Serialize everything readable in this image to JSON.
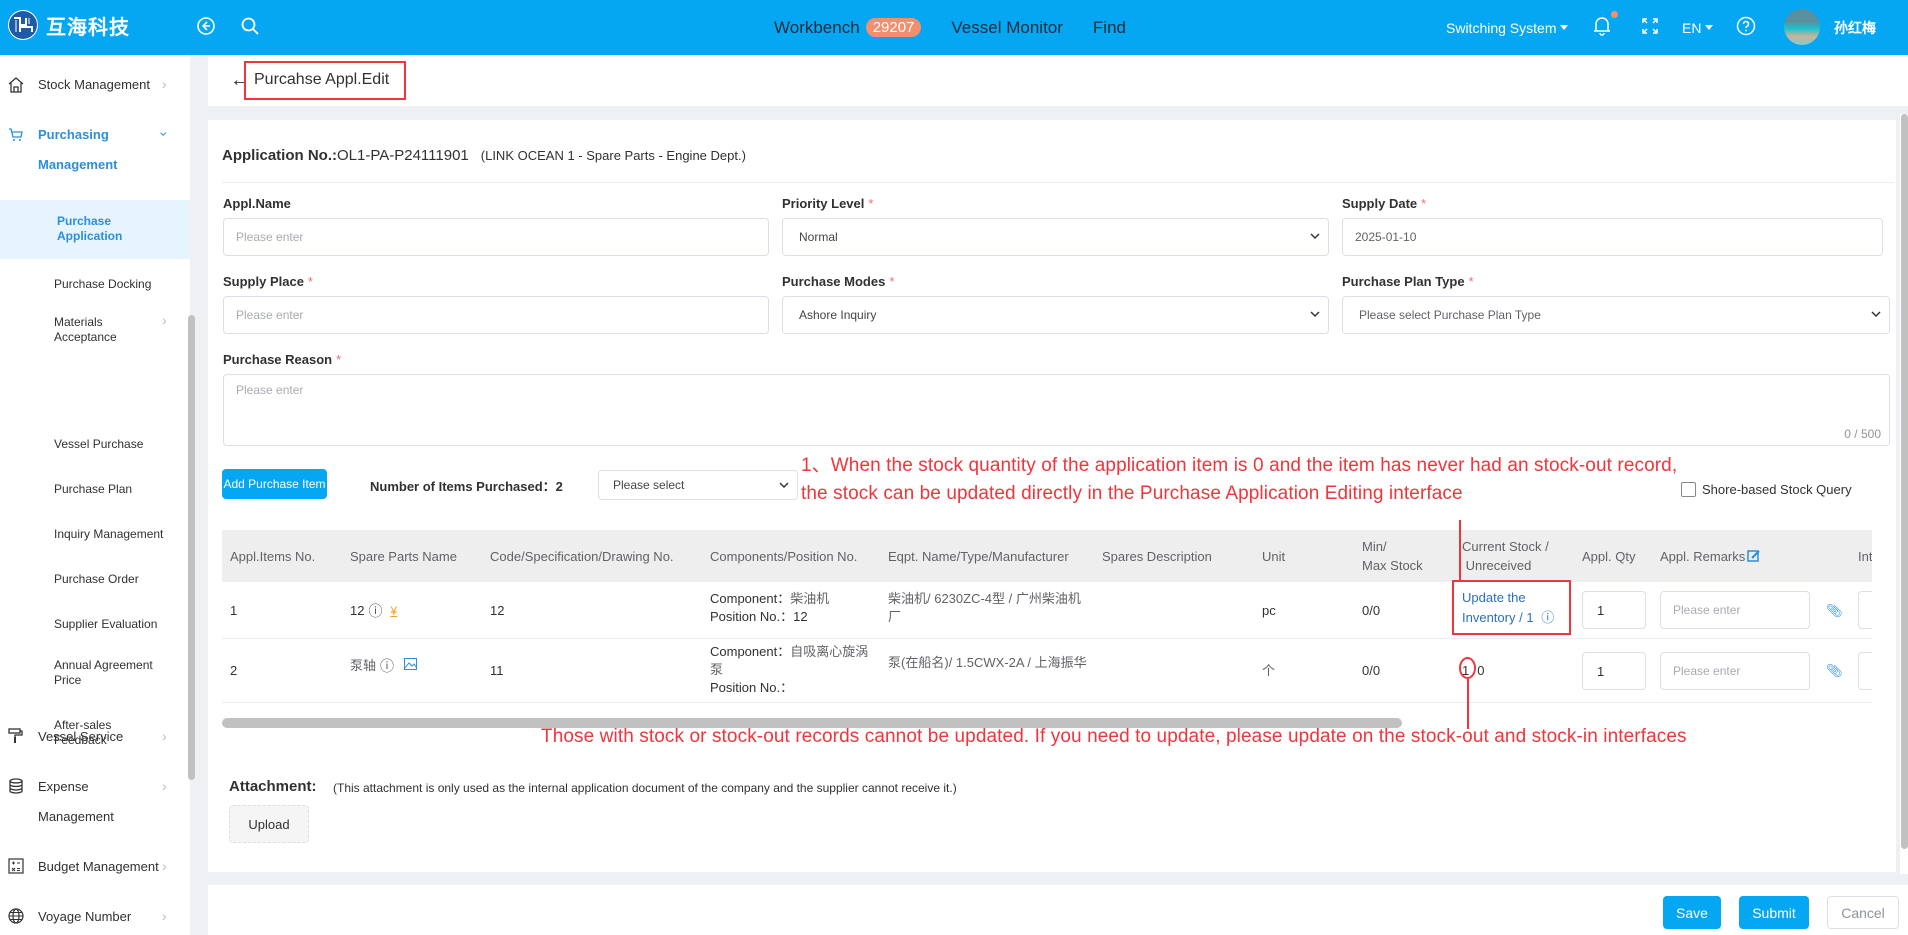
{
  "header": {
    "brand": "互海科技",
    "nav": [
      {
        "label": "Workbench",
        "badge": "29207"
      },
      {
        "label": "Vessel Monitor"
      },
      {
        "label": "Find"
      }
    ],
    "switching_system": "Switching System",
    "language": "EN",
    "user_name": "孙红梅",
    "badge_color": "#f48f6e",
    "accent_color": "#05a7f2"
  },
  "sidebar": {
    "items": [
      {
        "label": "Stock Management",
        "icon": "home-icon"
      },
      {
        "label": "Purchasing",
        "label2": "Management",
        "icon": "cart-icon",
        "expanded": true
      },
      {
        "label": "Vessel Service",
        "icon": "paint-roller-icon"
      },
      {
        "label": "Expense",
        "label2": "Management",
        "icon": "database-icon"
      },
      {
        "label": "Budget Management",
        "icon": "calculator-icon"
      },
      {
        "label": "Voyage Number",
        "icon": "globe-icon"
      }
    ],
    "sub_items": [
      {
        "label": "Purchase",
        "label2": "Application",
        "active": true
      },
      {
        "label": "Purchase Docking"
      },
      {
        "label": "Materials",
        "label2": "Acceptance",
        "has_children": true
      },
      {
        "label": "Vessel Purchase"
      },
      {
        "label": "Purchase Plan"
      },
      {
        "label": "Inquiry Management"
      },
      {
        "label": "Purchase Order"
      },
      {
        "label": "Supplier Evaluation"
      },
      {
        "label": "Annual Agreement",
        "label2": "Price"
      },
      {
        "label": "After-sales",
        "label2": "Feedback"
      }
    ]
  },
  "page": {
    "title": "Purcahse Appl.Edit",
    "application_no_label": "Application No.:",
    "application_no": "OL1-PA-P24111901",
    "application_sub": "(LINK OCEAN 1 - Spare Parts - Engine Dept.)"
  },
  "form": {
    "appl_name": {
      "label": "Appl.Name",
      "placeholder": "Please enter",
      "value": ""
    },
    "priority_level": {
      "label": "Priority Level",
      "required": "*",
      "value": "Normal"
    },
    "supply_date": {
      "label": "Supply Date",
      "required": "*",
      "value": "2025-01-10"
    },
    "supply_place": {
      "label": "Supply Place",
      "required": "*",
      "placeholder": "Please enter",
      "value": ""
    },
    "purchase_modes": {
      "label": "Purchase Modes",
      "required": "*",
      "value": "Ashore Inquiry"
    },
    "purchase_plan_type": {
      "label": "Purchase Plan Type",
      "required": "*",
      "placeholder": "Please select Purchase Plan Type"
    },
    "purchase_reason": {
      "label": "Purchase Reason",
      "required": "*",
      "placeholder": "Please enter",
      "counter": "0 / 500"
    }
  },
  "items_toolbar": {
    "add_button": "Add Purchase Item",
    "count_label": "Number of Items Purchased：",
    "count": "2",
    "filter_placeholder": "Please select",
    "shore_stock_query": "Shore-based Stock Query",
    "shore_stock_checked": false
  },
  "annotations": {
    "top_line1": "1、When the stock quantity of the application item is 0 and the item has never had an stock-out record,",
    "top_line2": "the stock can be updated directly in the Purchase Application Editing interface",
    "bottom": "Those with stock or stock-out records cannot be updated. If you need to update, please update on the stock-out and stock-in interfaces",
    "color": "#f0353c"
  },
  "table": {
    "columns": [
      "Appl.Items No.",
      "Spare Parts Name",
      "Code/Specification/Drawing No.",
      "Components/Position No.",
      "Eqpt. Name/Type/Manufacturer",
      "Spares Description",
      "Unit",
      "Min/\nMax Stock",
      "Current Stock /\n Unreceived",
      "Appl. Qty",
      "Appl. Remarks",
      "Int"
    ],
    "rows": [
      {
        "no": "1",
        "name": "12",
        "name_icon": "price-tag-icon",
        "code": "12",
        "component_label": "Component：",
        "component": "柴油机",
        "position_label": "Position No.：",
        "position": "12",
        "eqpt": "柴油机/ 6230ZC-4型 / 广州柴油机厂",
        "description": "",
        "unit": "pc",
        "min_max": "0/0",
        "current_stock_link": "Update the Inventory",
        "unreceived": "/ 1",
        "appl_qty": "1",
        "remarks_placeholder": "Please enter"
      },
      {
        "no": "2",
        "name": "泵轴",
        "name_icon": "image-icon",
        "code": "11",
        "component_label": "Component：",
        "component": "自吸离心旋涡泵",
        "position_label": "Position No.：",
        "position": "",
        "eqpt": "泵(在船名)/ 1.5CWX-2A / 上海振华",
        "description": "",
        "unit": "个",
        "min_max": "0/0",
        "current_stock": "1",
        "unreceived": "0",
        "appl_qty": "1",
        "remarks_placeholder": "Please enter"
      }
    ]
  },
  "attachment": {
    "label": "Attachment:",
    "note": "(This attachment is only used as the internal application document of the company and the supplier cannot receive it.)",
    "upload": "Upload"
  },
  "footer": {
    "save": "Save",
    "submit": "Submit",
    "cancel": "Cancel"
  }
}
